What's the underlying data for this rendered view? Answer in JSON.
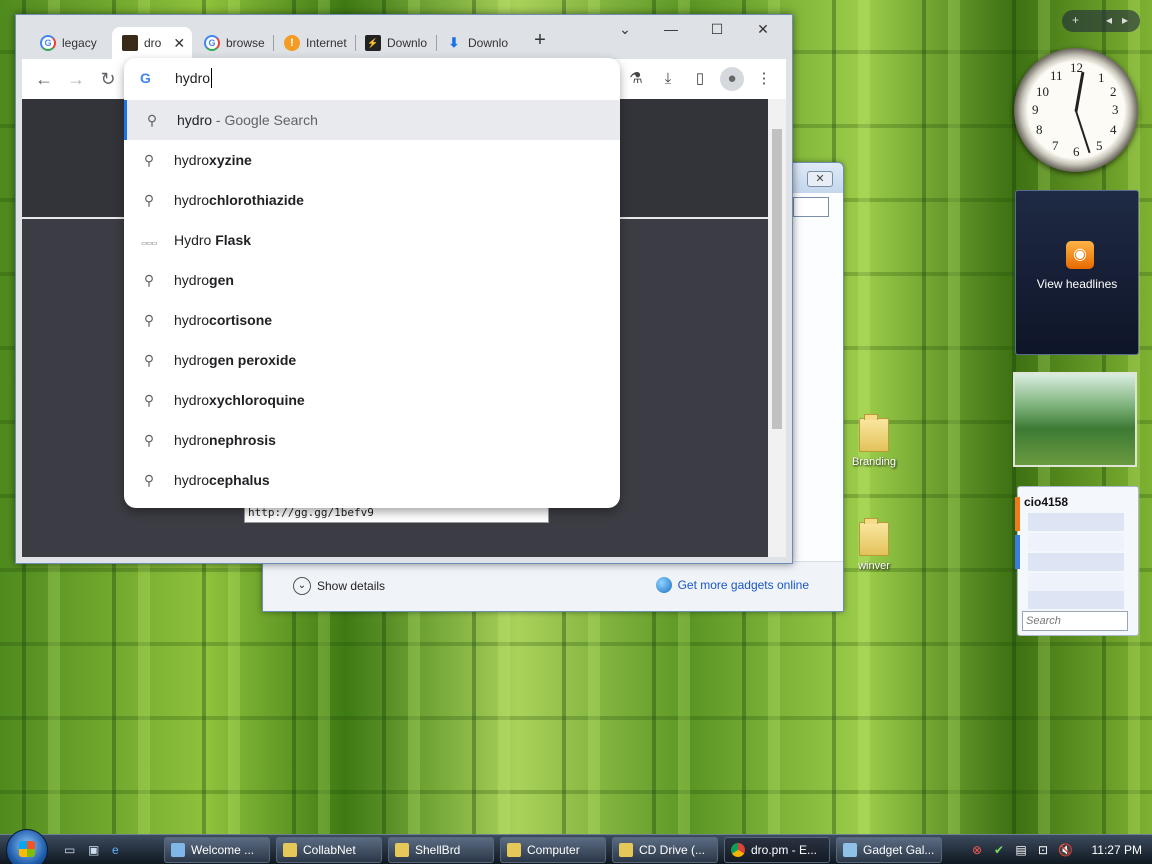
{
  "chrome": {
    "tabs": [
      {
        "label": "legacy",
        "favicon": "google-icon"
      },
      {
        "label": "dro",
        "favicon": "site-icon"
      },
      {
        "label": "browse",
        "favicon": "google-icon"
      },
      {
        "label": "Internet",
        "favicon": "orange-site-icon"
      },
      {
        "label": "Downlo",
        "favicon": "download-site-icon"
      },
      {
        "label": "Downlo",
        "favicon": "download-icon"
      }
    ],
    "new_tab_label": "+",
    "omnibox": {
      "value": "hydro",
      "suggestions": [
        {
          "prefix": "hydro",
          "bold": "",
          "suffix": " - Google Search",
          "icon": "search-icon",
          "highlighted": true
        },
        {
          "prefix": "hydro",
          "bold": "xyzine",
          "suffix": "",
          "icon": "search-icon"
        },
        {
          "prefix": "hydro",
          "bold": "chlorothiazide",
          "suffix": "",
          "icon": "search-icon"
        },
        {
          "prefix": "Hydro ",
          "bold": "Flask",
          "suffix": "",
          "icon": "brand-logo-icon"
        },
        {
          "prefix": "hydro",
          "bold": "gen",
          "suffix": "",
          "icon": "search-icon"
        },
        {
          "prefix": "hydro",
          "bold": "cortisone",
          "suffix": "",
          "icon": "search-icon"
        },
        {
          "prefix": "hydro",
          "bold": "gen peroxide",
          "suffix": "",
          "icon": "search-icon"
        },
        {
          "prefix": "hydro",
          "bold": "xychloroquine",
          "suffix": "",
          "icon": "search-icon"
        },
        {
          "prefix": "hydro",
          "bold": "nephrosis",
          "suffix": "",
          "icon": "search-icon"
        },
        {
          "prefix": "hydro",
          "bold": "cephalus",
          "suffix": "",
          "icon": "search-icon"
        }
      ]
    },
    "page": {
      "url_text": "http://gg.gg/1befv9"
    }
  },
  "gallery": {
    "show_details": "Show details",
    "more_gadgets": "Get more gadgets online"
  },
  "desktop": {
    "icons": [
      {
        "label": "Branding"
      },
      {
        "label": "winver"
      }
    ]
  },
  "gadgets": {
    "rss_label": "View headlines",
    "contact_name": "cio4158",
    "contact_search_placeholder": "Search"
  },
  "taskbar": {
    "tasks": [
      {
        "label": "Welcome ..."
      },
      {
        "label": "CollabNet"
      },
      {
        "label": "ShellBrd"
      },
      {
        "label": "Computer"
      },
      {
        "label": "CD Drive (..."
      },
      {
        "label": "dro.pm - E..."
      },
      {
        "label": "Gadget Gal..."
      }
    ],
    "time": "11:27 PM"
  },
  "colors": {
    "accent": "#1a73e8",
    "rss": "#e66a00"
  }
}
